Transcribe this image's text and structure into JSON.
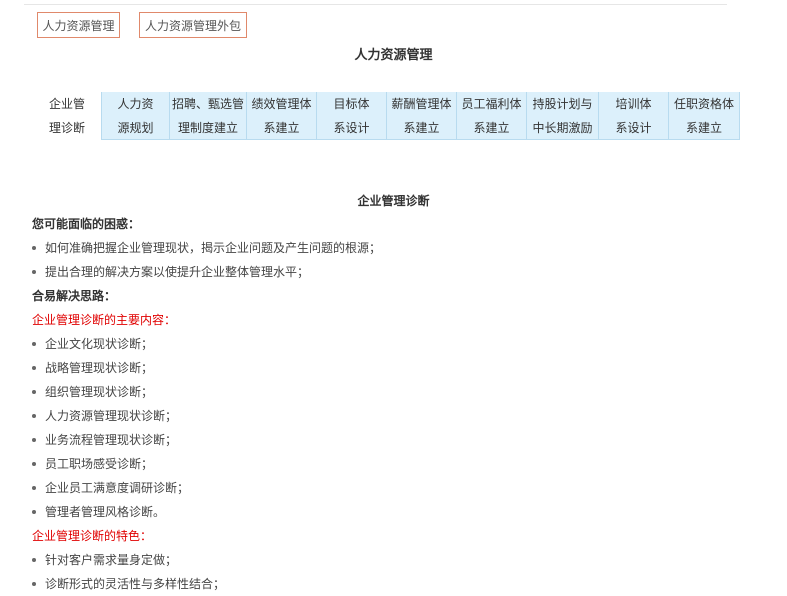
{
  "top_tabs": [
    "人力资源管理",
    "人力资源管理外包"
  ],
  "page_title": "人力资源管理",
  "menu": [
    {
      "l1": "企业管",
      "l2": "理诊断"
    },
    {
      "l1": "人力资",
      "l2": "源规划"
    },
    {
      "l1": "招聘、甄选管",
      "l2": "理制度建立"
    },
    {
      "l1": "绩效管理体",
      "l2": "系建立"
    },
    {
      "l1": "目标体",
      "l2": "系设计"
    },
    {
      "l1": "薪酬管理体",
      "l2": "系建立"
    },
    {
      "l1": "员工福利体",
      "l2": "系建立"
    },
    {
      "l1": "持股计划与",
      "l2": "中长期激励"
    },
    {
      "l1": "培训体",
      "l2": "系设计"
    },
    {
      "l1": "任职资格体",
      "l2": "系建立"
    }
  ],
  "section_title": "企业管理诊断",
  "content": {
    "difficulties_heading": "您可能面临的困惑：",
    "difficulties": [
      "如何准确把握企业管理现状，揭示企业问题及产生问题的根源；",
      "提出合理的解决方案以使提升企业整体管理水平；"
    ],
    "approach_heading": "合易解决思路：",
    "main_content_heading": "企业管理诊断的主要内容：",
    "main_content": [
      "企业文化现状诊断；",
      "战略管理现状诊断；",
      "组织管理现状诊断；",
      "人力资源管理现状诊断；",
      "业务流程管理现状诊断；",
      "员工职场感受诊断；",
      "企业员工满意度调研诊断；",
      "管理者管理风格诊断。"
    ],
    "features_heading": "企业管理诊断的特色：",
    "features": [
      "针对客户需求量身定做；",
      "诊断形式的灵活性与多样性结合；"
    ]
  }
}
